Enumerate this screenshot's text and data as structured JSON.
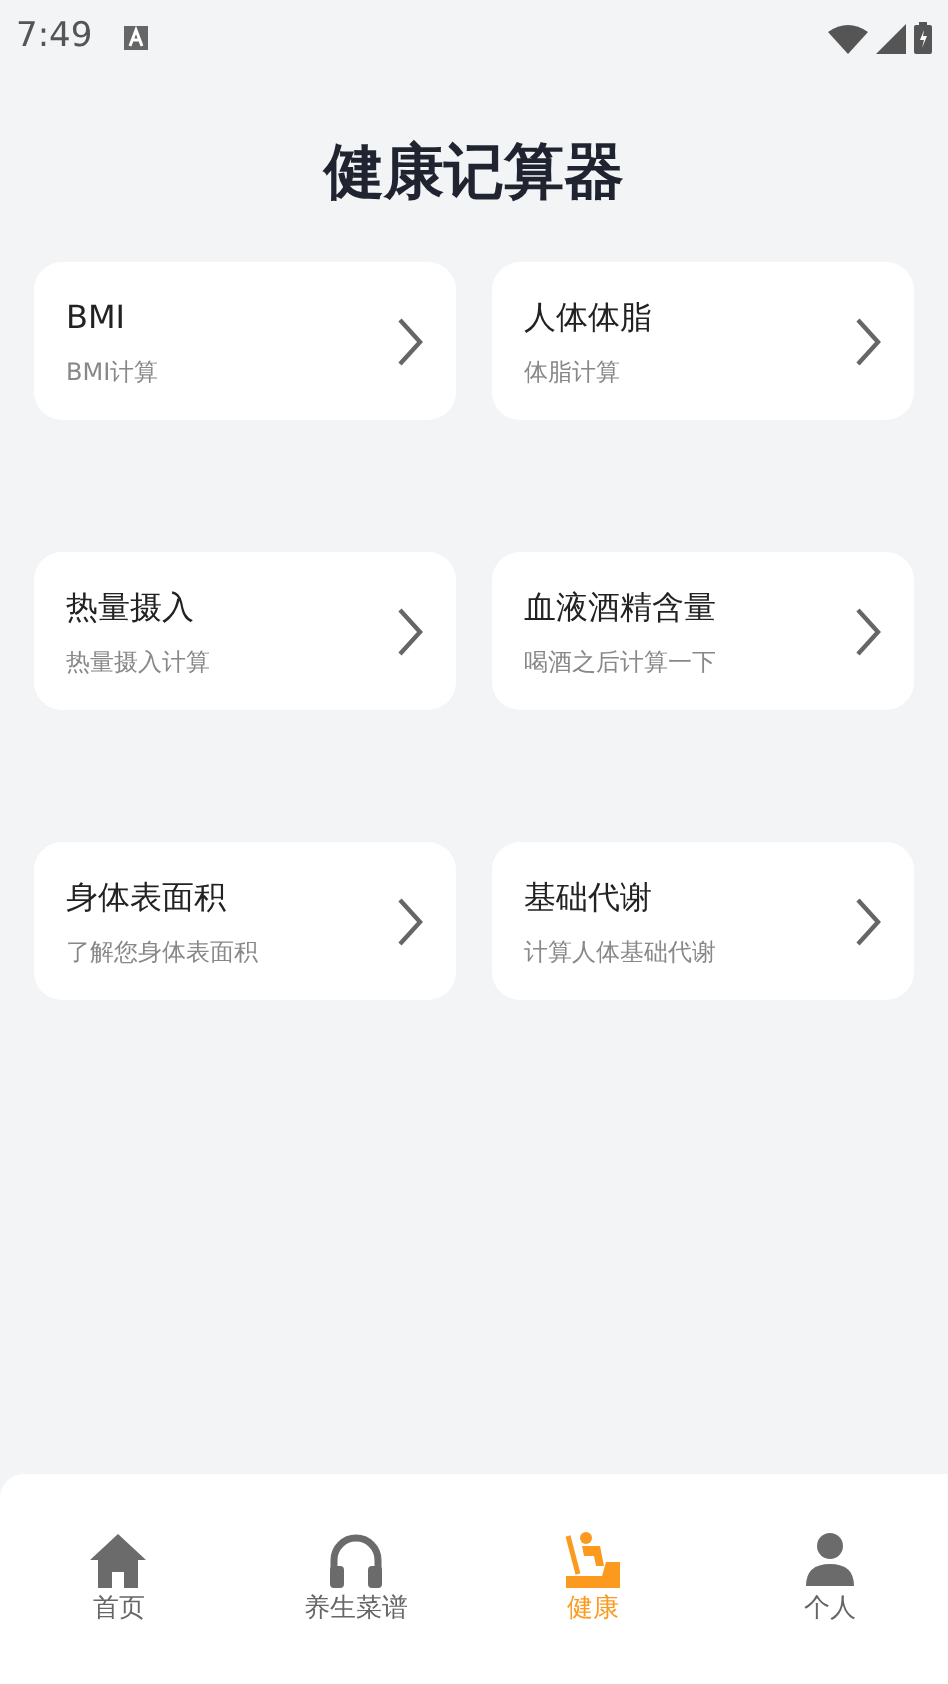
{
  "status_bar": {
    "time": "7:49"
  },
  "title": "健康记算器",
  "cards": [
    {
      "title": "BMI",
      "subtitle": "BMI计算"
    },
    {
      "title": "人体体脂",
      "subtitle": "体脂计算"
    },
    {
      "title": "热量摄入",
      "subtitle": "热量摄入计算"
    },
    {
      "title": "血液酒精含量",
      "subtitle": "喝酒之后计算一下"
    },
    {
      "title": "身体表面积",
      "subtitle": "了解您身体表面积"
    },
    {
      "title": "基础代谢",
      "subtitle": "计算人体基础代谢"
    }
  ],
  "tab_bar": [
    {
      "label": "首页",
      "selected": false
    },
    {
      "label": "养生菜谱",
      "selected": false
    },
    {
      "label": "健康",
      "selected": true
    },
    {
      "label": "个人",
      "selected": false
    }
  ]
}
